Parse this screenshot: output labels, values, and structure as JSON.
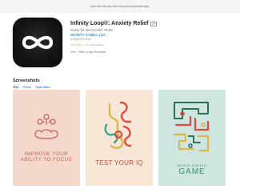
{
  "topbar": {
    "text": "Open the Mac App Store to buy and download apps."
  },
  "app": {
    "title": "Infinity Loop®: Anxiety Relief",
    "age_rating": "4+",
    "subtitle": "Game for stress relief. Relax",
    "developer": "INFINITY GAMES, LDA",
    "designed_for": "Designed for iPad",
    "stars": "★★★★☆",
    "rating_text": "4.6 • 141 Ratings",
    "price": "Free · Offers In-App Purchases",
    "icon": "infinity-loop-icon",
    "icon_background": "#141414"
  },
  "screenshots": {
    "section_title": "Screenshots",
    "device_tabs": [
      "iPad",
      "iPhone",
      "Apple Watch"
    ],
    "items": [
      {
        "caption_line1": "IMPROVE YOUR",
        "caption_line2": "ABILITY TO FOCUS",
        "background": "#f4d8cb"
      },
      {
        "caption": "TEST YOUR IQ",
        "background": "#f8e7d6"
      },
      {
        "caption_small": "NEVER-ENDING",
        "caption": "GAME",
        "background": "#cfe6e0"
      }
    ]
  }
}
